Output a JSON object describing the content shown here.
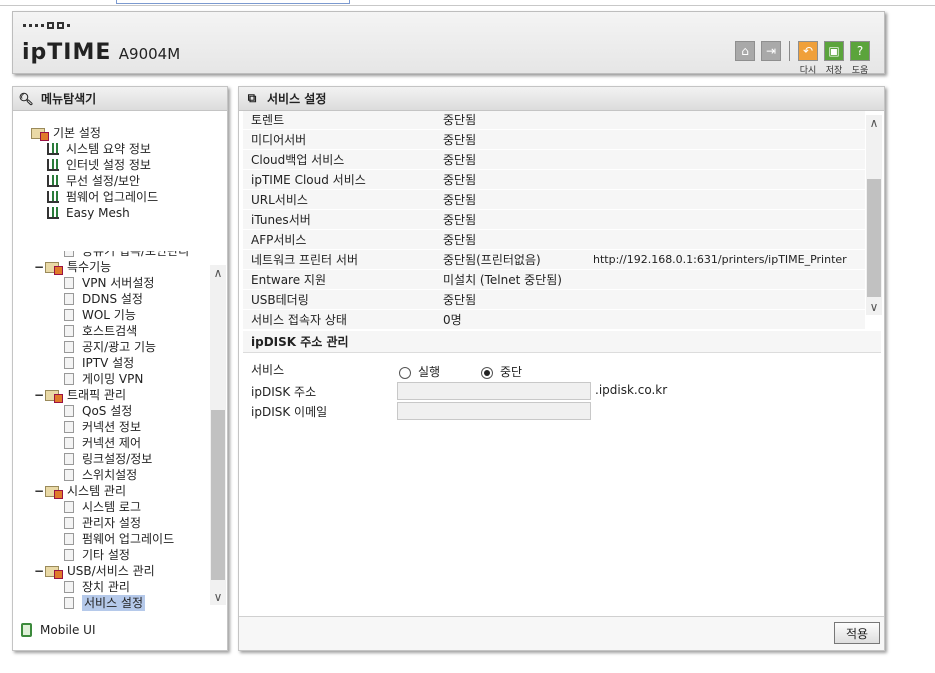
{
  "header": {
    "brand": "ipTIME",
    "model": "A9004M",
    "actions": [
      {
        "icon": "home-icon",
        "label": ""
      },
      {
        "icon": "logout-icon",
        "label": ""
      },
      {
        "icon": "undo-icon",
        "label": "다시"
      },
      {
        "icon": "save-icon",
        "label": "저장"
      },
      {
        "icon": "help-icon",
        "label": "도움"
      }
    ]
  },
  "nav": {
    "title": "메뉴탐색기",
    "basic_group": "기본 설정",
    "basic_items": [
      "시스템 요약 정보",
      "인터넷 설정 정보",
      "무선 설정/보안",
      "펌웨어 업그레이드",
      "Easy Mesh"
    ],
    "partial_item": "공유기 접속/보안관리",
    "groups": [
      {
        "label": "특수기능",
        "items": [
          "VPN 서버설정",
          "DDNS 설정",
          "WOL 기능",
          "호스트검색",
          "공지/광고 기능",
          "IPTV 설정",
          "게이밍 VPN"
        ]
      },
      {
        "label": "트래픽 관리",
        "items": [
          "QoS 설정",
          "커넥션 정보",
          "커넥션 제어",
          "링크설정/정보",
          "스위치설정"
        ]
      },
      {
        "label": "시스템 관리",
        "items": [
          "시스템 로그",
          "관리자 설정",
          "펌웨어 업그레이드",
          "기타 설정"
        ]
      },
      {
        "label": "USB/서비스 관리",
        "items": [
          "장치 관리",
          "서비스 설정"
        ]
      }
    ],
    "selected": "서비스 설정",
    "mobile": "Mobile UI"
  },
  "main": {
    "title": "서비스 설정",
    "services": [
      {
        "name": "토렌트",
        "status": "중단됨",
        "extra": ""
      },
      {
        "name": "미디어서버",
        "status": "중단됨",
        "extra": ""
      },
      {
        "name": "Cloud백업 서비스",
        "status": "중단됨",
        "extra": ""
      },
      {
        "name": "ipTIME Cloud 서비스",
        "status": "중단됨",
        "extra": ""
      },
      {
        "name": "URL서비스",
        "status": "중단됨",
        "extra": ""
      },
      {
        "name": "iTunes서버",
        "status": "중단됨",
        "extra": ""
      },
      {
        "name": "AFP서비스",
        "status": "중단됨",
        "extra": ""
      },
      {
        "name": "네트워크 프린터 서버",
        "status": "중단됨(프린터없음)",
        "extra": "http://192.168.0.1:631/printers/ipTIME_Printer"
      },
      {
        "name": "Entware 지원",
        "status": "미설치 (Telnet 중단됨)",
        "extra": ""
      },
      {
        "name": "USB테더링",
        "status": "중단됨",
        "extra": ""
      },
      {
        "name": "서비스 접속자 상태",
        "status": "0명",
        "extra": ""
      }
    ],
    "ipdisk": {
      "title": "ipDISK 주소 관리",
      "service_label": "서비스",
      "run_label": "실행",
      "stop_label": "중단",
      "selected": "중단",
      "address_label": "ipDISK 주소",
      "address_value": "",
      "domain_suffix": ".ipdisk.co.kr",
      "email_label": "ipDISK 이메일",
      "email_value": ""
    },
    "apply_label": "적용"
  }
}
